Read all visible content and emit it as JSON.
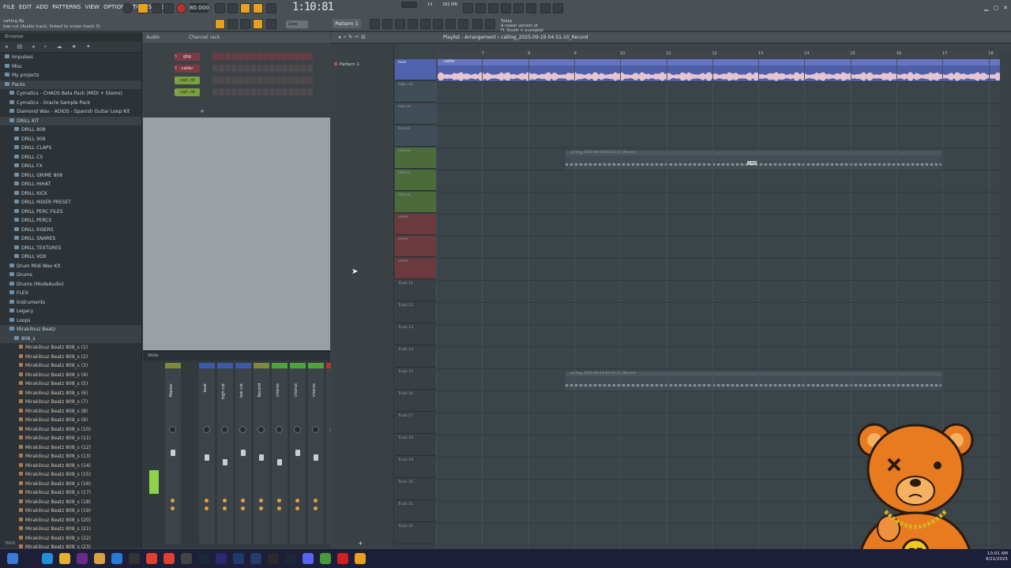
{
  "menu": [
    "FILE",
    "EDIT",
    "ADD",
    "PATTERNS",
    "VIEW",
    "OPTIONS",
    "TOOLS",
    "HELP"
  ],
  "project_file": "calling.flp",
  "hint": "low cut (Audio track, linked to mixer track 3)",
  "tempo": "80.000",
  "time": "1:10:81",
  "pattern_select": "Pattern 1",
  "snap_mode": "Line",
  "news": [
    "Today",
    "A newer version of",
    "FL Studio is available!"
  ],
  "meters": {
    "cpu": "14",
    "ram": "282 MB",
    "ram2": "1"
  },
  "browser": {
    "title": "Browser",
    "tags_label": "TAGS",
    "items": [
      {
        "label": "Impulses",
        "t": "folder",
        "ind": 1
      },
      {
        "label": "Misc",
        "t": "folder",
        "ind": 1
      },
      {
        "label": "My projects",
        "t": "folder",
        "ind": 1
      },
      {
        "label": "Packs",
        "t": "folder",
        "ind": 1,
        "sel": true
      },
      {
        "label": "Cymatics - CHAOS Beta Pack (MIDI + Stems)",
        "t": "folder",
        "ind": 2
      },
      {
        "label": "Cymatics - Oracle Sample Pack",
        "t": "folder",
        "ind": 2
      },
      {
        "label": "Diamond Wav - ADIOS - Spanish Guitar Loop Kit",
        "t": "folder",
        "ind": 2
      },
      {
        "label": "DRILL KIT",
        "t": "folder",
        "ind": 2,
        "sel": true
      },
      {
        "label": "DRILL 808",
        "t": "folder",
        "ind": 3
      },
      {
        "label": "DRILL 909",
        "t": "folder",
        "ind": 3
      },
      {
        "label": "DRILL CLAPS",
        "t": "folder",
        "ind": 3
      },
      {
        "label": "DRILL CS",
        "t": "folder",
        "ind": 3
      },
      {
        "label": "DRILL FX",
        "t": "folder",
        "ind": 3
      },
      {
        "label": "DRILL GRIME 808",
        "t": "folder",
        "ind": 3
      },
      {
        "label": "DRILL HIHAT",
        "t": "folder",
        "ind": 3
      },
      {
        "label": "DRILL KICK",
        "t": "folder",
        "ind": 3
      },
      {
        "label": "DRILL MIXER PRESET",
        "t": "folder",
        "ind": 3
      },
      {
        "label": "DRILL PERC FILES",
        "t": "folder",
        "ind": 3
      },
      {
        "label": "DRILL PERCS",
        "t": "folder",
        "ind": 3
      },
      {
        "label": "DRILL RISERS",
        "t": "folder",
        "ind": 3
      },
      {
        "label": "DRILL SNARES",
        "t": "folder",
        "ind": 3
      },
      {
        "label": "DRILL TEXTURES",
        "t": "folder",
        "ind": 3
      },
      {
        "label": "DRILL VOX",
        "t": "folder",
        "ind": 3
      },
      {
        "label": "Drum Midi Wav Kit",
        "t": "folder",
        "ind": 2
      },
      {
        "label": "Drums",
        "t": "folder",
        "ind": 2
      },
      {
        "label": "Drums (ModeAudio)",
        "t": "folder",
        "ind": 2
      },
      {
        "label": "FLEX",
        "t": "folder",
        "ind": 2
      },
      {
        "label": "Instruments",
        "t": "folder",
        "ind": 2
      },
      {
        "label": "Legacy",
        "t": "folder",
        "ind": 2
      },
      {
        "label": "Loops",
        "t": "folder",
        "ind": 2
      },
      {
        "label": "Mirakilouz Beatz",
        "t": "folder",
        "ind": 2,
        "sel": true
      },
      {
        "label": "808_s",
        "t": "folder",
        "ind": 3,
        "sel": true
      },
      {
        "label": "Mirakilouz Beatz 808_s (1)",
        "t": "file",
        "ind": 4
      },
      {
        "label": "Mirakilouz Beatz 808_s (2)",
        "t": "file",
        "ind": 4
      },
      {
        "label": "Mirakilouz Beatz 808_s (3)",
        "t": "file",
        "ind": 4
      },
      {
        "label": "Mirakilouz Beatz 808_s (4)",
        "t": "file",
        "ind": 4
      },
      {
        "label": "Mirakilouz Beatz 808_s (5)",
        "t": "file",
        "ind": 4
      },
      {
        "label": "Mirakilouz Beatz 808_s (6)",
        "t": "file",
        "ind": 4
      },
      {
        "label": "Mirakilouz Beatz 808_s (7)",
        "t": "file",
        "ind": 4
      },
      {
        "label": "Mirakilouz Beatz 808_s (8)",
        "t": "file",
        "ind": 4
      },
      {
        "label": "Mirakilouz Beatz 808_s (9)",
        "t": "file",
        "ind": 4
      },
      {
        "label": "Mirakilouz Beatz 808_s (10)",
        "t": "file",
        "ind": 4
      },
      {
        "label": "Mirakilouz Beatz 808_s (11)",
        "t": "file",
        "ind": 4
      },
      {
        "label": "Mirakilouz Beatz 808_s (12)",
        "t": "file",
        "ind": 4
      },
      {
        "label": "Mirakilouz Beatz 808_s (13)",
        "t": "file",
        "ind": 4
      },
      {
        "label": "Mirakilouz Beatz 808_s (14)",
        "t": "file",
        "ind": 4
      },
      {
        "label": "Mirakilouz Beatz 808_s (15)",
        "t": "file",
        "ind": 4
      },
      {
        "label": "Mirakilouz Beatz 808_s (16)",
        "t": "file",
        "ind": 4
      },
      {
        "label": "Mirakilouz Beatz 808_s (17)",
        "t": "file",
        "ind": 4
      },
      {
        "label": "Mirakilouz Beatz 808_s (18)",
        "t": "file",
        "ind": 4
      },
      {
        "label": "Mirakilouz Beatz 808_s (19)",
        "t": "file",
        "ind": 4
      },
      {
        "label": "Mirakilouz Beatz 808_s (20)",
        "t": "file",
        "ind": 4
      },
      {
        "label": "Mirakilouz Beatz 808_s (21)",
        "t": "file",
        "ind": 4
      },
      {
        "label": "Mirakilouz Beatz 808_s (22)",
        "t": "file",
        "ind": 4
      },
      {
        "label": "Mirakilouz Beatz 808_s (23)",
        "t": "file",
        "ind": 4
      }
    ]
  },
  "channel_rack": {
    "title": "Channel rack",
    "filter": "Audio",
    "channels": [
      {
        "name": "gbp",
        "num": "5",
        "color": "red"
      },
      {
        "name": "caller",
        "num": "5",
        "color": "red"
      },
      {
        "name": "call..rd",
        "num": "3",
        "color": "green"
      },
      {
        "name": "call..rd",
        "num": "5",
        "color": "green"
      }
    ]
  },
  "mixer": {
    "view": "Wide",
    "strips": [
      {
        "name": "Master",
        "color": "#7d8a3a"
      },
      {
        "name": "beat",
        "color": "#3b5aa8"
      },
      {
        "name": "high cut",
        "color": "#3b5aa8"
      },
      {
        "name": "low cut",
        "color": "#3b5aa8"
      },
      {
        "name": "Record",
        "color": "#7d8a3a"
      },
      {
        "name": "chorus",
        "color": "#4da53a"
      },
      {
        "name": "chorus",
        "color": "#4da53a"
      },
      {
        "name": "chorus",
        "color": "#4da53a"
      },
      {
        "name": "verse",
        "color": "#b83236"
      }
    ]
  },
  "playlist": {
    "title": "Playlist - Arrangement",
    "arrangement": "calling_2025-09-19 04-51-10_Record",
    "pattern": "Pattern 1",
    "ruler": [
      "7",
      "8",
      "9",
      "10",
      "11",
      "12",
      "13",
      "14",
      "15",
      "16",
      "17",
      "18"
    ],
    "beat_clip": "caller",
    "record_clip_1": "calling_2025-09-19 04-51-10_Record",
    "record_clip_2": "calling_2025-09-19 04-51-10_Record",
    "clip_tag": "5 fit5",
    "tracks": [
      "beat",
      "high cut",
      "low cut",
      "Record",
      "chorus",
      "chorus",
      "chorus",
      "verse",
      "verse",
      "verse",
      "Track 11",
      "Track 12",
      "Track 13",
      "Track 14",
      "Track 15",
      "Track 16",
      "Track 17",
      "Track 18",
      "Track 19",
      "Track 20",
      "Track 21",
      "Track 22"
    ]
  },
  "taskbar": {
    "time": "10:01 AM",
    "date": "9/21/2025"
  },
  "colors": {
    "accent": "#e8a020",
    "beat_clip": "#4e5fa8",
    "red_channel": "#7e3a44",
    "green_channel": "#7aa03e"
  }
}
